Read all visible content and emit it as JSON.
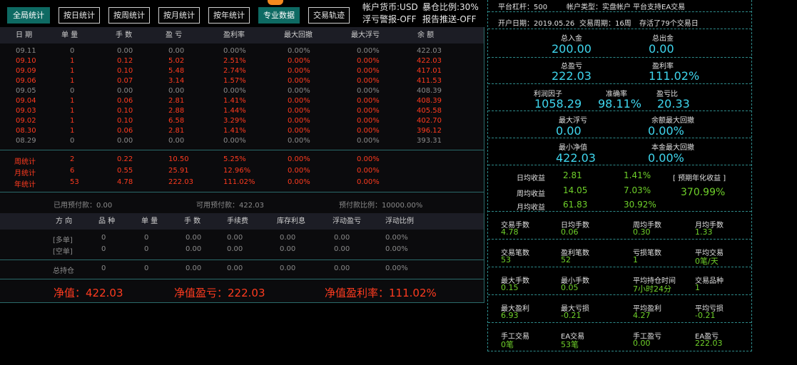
{
  "toolbar": {
    "buttons": [
      {
        "label": "全局统计",
        "active": true
      },
      {
        "label": "按日统计",
        "active": false
      },
      {
        "label": "按周统计",
        "active": false
      },
      {
        "label": "按月统计",
        "active": false
      },
      {
        "label": "按年统计",
        "active": false
      },
      {
        "label": "专业数据",
        "active": true
      },
      {
        "label": "交易轨迹",
        "active": false
      }
    ],
    "account_currency": "帐户货币:USD",
    "exposure_ratio": "暴仓比例:30%",
    "loss_alert": "浮亏警报-OFF",
    "report_push": "报告推送-OFF"
  },
  "daily": {
    "headers": [
      "日 期",
      "单 量",
      "手 数",
      "盈 亏",
      "盈利率",
      "最大回撤",
      "最大浮亏",
      "余 额"
    ],
    "rows": [
      {
        "date": "09.11",
        "orders": "0",
        "lots": "0.00",
        "pl": "0.00",
        "rate": "0.00%",
        "dd": "0.00%",
        "float": "0.00%",
        "balance": "422.03",
        "color": "gray"
      },
      {
        "date": "09.10",
        "orders": "1",
        "lots": "0.12",
        "pl": "5.02",
        "rate": "2.51%",
        "dd": "0.00%",
        "float": "0.00%",
        "balance": "422.03",
        "color": "red"
      },
      {
        "date": "09.09",
        "orders": "1",
        "lots": "0.10",
        "pl": "5.48",
        "rate": "2.74%",
        "dd": "0.00%",
        "float": "0.00%",
        "balance": "417.01",
        "color": "red"
      },
      {
        "date": "09.06",
        "orders": "1",
        "lots": "0.07",
        "pl": "3.14",
        "rate": "1.57%",
        "dd": "0.00%",
        "float": "0.00%",
        "balance": "411.53",
        "color": "red"
      },
      {
        "date": "09.05",
        "orders": "0",
        "lots": "0.00",
        "pl": "0.00",
        "rate": "0.00%",
        "dd": "0.00%",
        "float": "0.00%",
        "balance": "408.39",
        "color": "gray"
      },
      {
        "date": "09.04",
        "orders": "1",
        "lots": "0.06",
        "pl": "2.81",
        "rate": "1.41%",
        "dd": "0.00%",
        "float": "0.00%",
        "balance": "408.39",
        "color": "red"
      },
      {
        "date": "09.03",
        "orders": "1",
        "lots": "0.10",
        "pl": "2.88",
        "rate": "1.44%",
        "dd": "0.00%",
        "float": "0.00%",
        "balance": "405.58",
        "color": "red"
      },
      {
        "date": "09.02",
        "orders": "1",
        "lots": "0.10",
        "pl": "6.58",
        "rate": "3.29%",
        "dd": "0.00%",
        "float": "0.00%",
        "balance": "402.70",
        "color": "red"
      },
      {
        "date": "08.30",
        "orders": "1",
        "lots": "0.06",
        "pl": "2.81",
        "rate": "1.41%",
        "dd": "0.00%",
        "float": "0.00%",
        "balance": "396.12",
        "color": "red"
      },
      {
        "date": "08.29",
        "orders": "0",
        "lots": "0.00",
        "pl": "0.00",
        "rate": "0.00%",
        "dd": "0.00%",
        "float": "0.00%",
        "balance": "393.31",
        "color": "gray"
      }
    ],
    "totals": [
      {
        "label": "周统计",
        "orders": "2",
        "lots": "0.22",
        "pl": "10.50",
        "rate": "5.25%",
        "dd": "0.00%",
        "float": "0.00%"
      },
      {
        "label": "月统计",
        "orders": "6",
        "lots": "0.55",
        "pl": "25.91",
        "rate": "12.96%",
        "dd": "0.00%",
        "float": "0.00%"
      },
      {
        "label": "年统计",
        "orders": "53",
        "lots": "4.78",
        "pl": "222.03",
        "rate": "111.02%",
        "dd": "0.00%",
        "float": "0.00%"
      }
    ]
  },
  "margin": {
    "used": "已用预付款：0.00",
    "available": "可用预付款：422.03",
    "ratio": "预付款比例：10000.00%"
  },
  "positions": {
    "headers": [
      "方 向",
      "品 种",
      "单 量",
      "手 数",
      "手续费",
      "库存利息",
      "浮动盈亏",
      "浮动比例"
    ],
    "rows": [
      {
        "dir": "[多单]",
        "symbol": "0",
        "orders": "0",
        "lots": "0.00",
        "fee": "0.00",
        "swap": "0.00",
        "fpl": "0.00",
        "fratio": "0.00%"
      },
      {
        "dir": "[空单]",
        "symbol": "0",
        "orders": "0",
        "lots": "0.00",
        "fee": "0.00",
        "swap": "0.00",
        "fpl": "0.00",
        "fratio": "0.00%"
      }
    ],
    "total": {
      "dir": "总持仓",
      "symbol": "0",
      "orders": "0",
      "lots": "0.00",
      "fee": "0.00",
      "swap": "0.00",
      "fpl": "0.00",
      "fratio": "0.00%"
    }
  },
  "summary": {
    "net_value": "净值：422.03",
    "net_pl": "净值盈亏：222.03",
    "net_rate": "净值盈利率：111.02%"
  },
  "info": {
    "leverage": "平台杠杆：500",
    "account_type": "帐户类型：实盘帐户",
    "ea_support": "平台支持EA交易",
    "open_date": "开户日期：2019.05.26",
    "trade_weeks": "交易周期：16周",
    "trade_days": "存活了79个交易日"
  },
  "stats": {
    "deposit_label": "总入金",
    "deposit": "200.00",
    "withdraw_label": "总出金",
    "withdraw": "0.00",
    "profit_label": "总盈亏",
    "profit": "222.03",
    "profit_rate_label": "盈利率",
    "profit_rate": "111.02%",
    "profit_factor_label": "利润因子",
    "profit_factor": "1058.29",
    "accuracy_label": "准确率",
    "accuracy": "98.11%",
    "pl_ratio_label": "盈亏比",
    "pl_ratio": "20.33",
    "max_float_label": "最大浮亏",
    "max_float": "0.00",
    "bal_dd_label": "余额最大回撤",
    "bal_dd": "0.00%",
    "min_equity_label": "最小净值",
    "min_equity": "422.03",
    "cap_dd_label": "本金最大回撤",
    "cap_dd": "0.00%"
  },
  "returns": {
    "daily_label": "日均收益",
    "daily_val": "2.81",
    "daily_pct": "1.41%",
    "weekly_label": "周均收益",
    "weekly_val": "14.05",
    "weekly_pct": "7.03%",
    "monthly_label": "月均收益",
    "monthly_val": "61.83",
    "monthly_pct": "30.92%",
    "annual_label": "[ 预期年化收益 ]",
    "annual_val": "370.99%"
  },
  "metrics": [
    [
      {
        "label": "交易手数",
        "value": "4.78"
      },
      {
        "label": "日均手数",
        "value": "0.06"
      },
      {
        "label": "周均手数",
        "value": "0.30"
      },
      {
        "label": "月均手数",
        "value": "1.33"
      }
    ],
    [
      {
        "label": "交易笔数",
        "value": "53"
      },
      {
        "label": "盈利笔数",
        "value": "52"
      },
      {
        "label": "亏损笔数",
        "value": "1"
      },
      {
        "label": "平均交易",
        "value": "0笔/天"
      }
    ],
    [
      {
        "label": "最大手数",
        "value": "0.15"
      },
      {
        "label": "最小手数",
        "value": "0.05"
      },
      {
        "label": "平均持仓时间",
        "value": "7小时24分"
      },
      {
        "label": "交易品种",
        "value": "1"
      }
    ],
    [
      {
        "label": "最大盈利",
        "value": "6.93"
      },
      {
        "label": "最大亏损",
        "value": "-0.21"
      },
      {
        "label": "平均盈利",
        "value": "4.27"
      },
      {
        "label": "平均亏损",
        "value": "-0.21"
      }
    ],
    [
      {
        "label": "手工交易",
        "value": "0笔"
      },
      {
        "label": "EA交易",
        "value": "53笔"
      },
      {
        "label": "手工盈亏",
        "value": "0.00"
      },
      {
        "label": "EA盈亏",
        "value": "222.03"
      }
    ]
  ]
}
